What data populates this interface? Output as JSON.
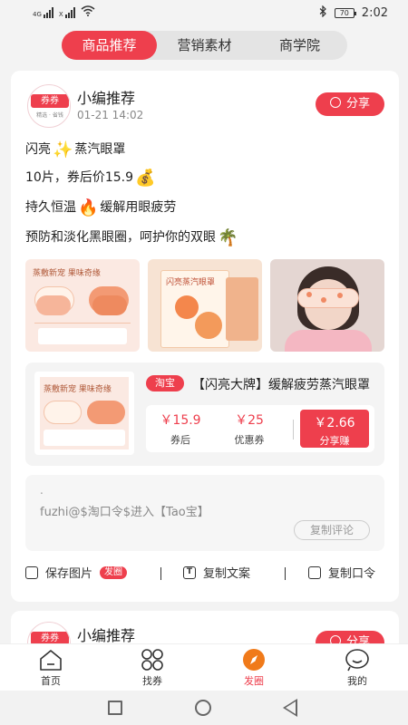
{
  "status_bar": {
    "signal_labels": [
      "4G",
      "X"
    ],
    "battery": "70",
    "time": "2:02"
  },
  "tabs": [
    {
      "label": "商品推荐",
      "active": true
    },
    {
      "label": "营销素材",
      "active": false
    },
    {
      "label": "商学院",
      "active": false
    }
  ],
  "post": {
    "avatar_tag": "券券",
    "avatar_sub": "精选 · 省钱",
    "author": "小编推荐",
    "time": "01-21 14:02",
    "share_label": "分享",
    "lines": [
      {
        "before": "闪亮",
        "emoji": "✨",
        "after": "蒸汽眼罩"
      },
      {
        "before": "10片，券后价15.9",
        "emoji": "💰",
        "after": ""
      },
      {
        "before": "持久恒温",
        "emoji": "🔥",
        "after": "缓解用眼疲劳"
      },
      {
        "before": "预防和淡化黑眼圈，呵护你的双眼",
        "emoji": "🌴",
        "after": ""
      }
    ],
    "image1_title": "蒸敷新宠 果味奇缘",
    "image2_title": "闪亮蒸汽眼罩",
    "product": {
      "platform": "淘宝",
      "title": "【闪亮大牌】缓解疲劳蒸汽眼罩",
      "image_title": "蒸敷新宠 果味奇缘",
      "price_after_coupon": "￥15.9",
      "price_after_coupon_label": "券后",
      "coupon": "￥25",
      "coupon_label": "优惠券",
      "share_earn": "￥2.66",
      "share_earn_label": "分享赚"
    },
    "comment": {
      "dot": ".",
      "text": "fuzhi@$淘口令$进入【Tao宝】",
      "copy_label": "复制评论"
    },
    "actions": {
      "save_image": "保存图片",
      "save_badge": "发圈",
      "copy_text": "复制文案",
      "copy_code": "复制口令"
    }
  },
  "post2": {
    "avatar_tag": "券券",
    "author": "小编推荐",
    "share_label": "分享"
  },
  "bottom_nav": [
    {
      "label": "首页",
      "icon": "home-icon",
      "active": false
    },
    {
      "label": "找券",
      "icon": "grid-icon",
      "active": false
    },
    {
      "label": "发圈",
      "icon": "compass-icon",
      "active": true
    },
    {
      "label": "我的",
      "icon": "user-icon",
      "active": false
    }
  ],
  "colors": {
    "accent": "#ee3f4d",
    "background": "#f3f3f3"
  }
}
